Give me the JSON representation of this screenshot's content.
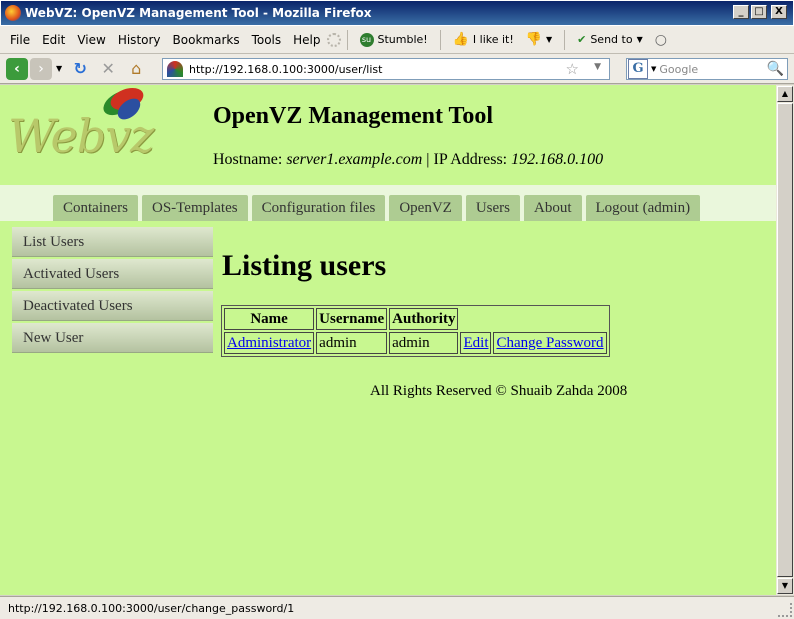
{
  "window": {
    "title": "WebVZ: OpenVZ Management Tool - Mozilla Firefox",
    "minimize": "_",
    "maximize": "□",
    "close": "X"
  },
  "menubar": {
    "items": [
      "File",
      "Edit",
      "View",
      "History",
      "Bookmarks",
      "Tools",
      "Help"
    ],
    "stumble": "Stumble!",
    "ilike": "I like it!",
    "sendto": "Send to"
  },
  "navbar": {
    "url": "http://192.168.0.100:3000/user/list",
    "search_placeholder": "Google"
  },
  "page": {
    "logo_text": "Webvz",
    "title": "OpenVZ Management Tool",
    "hostname_label": "Hostname:",
    "hostname": "server1.example.com",
    "separator": "|",
    "ip_label": "IP Address:",
    "ip": "192.168.0.100",
    "tabs": [
      "Containers",
      "OS-Templates",
      "Configuration files",
      "OpenVZ",
      "Users",
      "About",
      "Logout (admin)"
    ],
    "side_menu": [
      "List Users",
      "Activated Users",
      "Deactivated Users",
      "New User"
    ],
    "heading": "Listing users",
    "table": {
      "headers": [
        "Name",
        "Username",
        "Authority"
      ],
      "rows": [
        {
          "name": "Administrator",
          "username": "admin",
          "authority": "admin",
          "edit": "Edit",
          "change_password": "Change Password"
        }
      ]
    },
    "footer": "All Rights Reserved © Shuaib Zahda 2008"
  },
  "statusbar": {
    "text": "http://192.168.0.100:3000/user/change_password/1"
  },
  "colors": {
    "page_bg": "#c8f790",
    "tab_bg": "#aecc92",
    "link": "#0000ee"
  }
}
